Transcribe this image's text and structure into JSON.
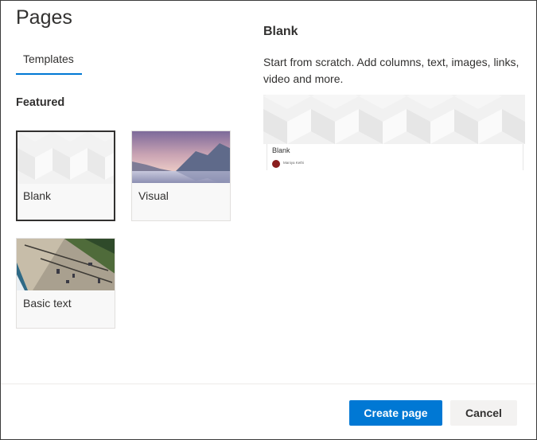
{
  "dialog": {
    "title": "Pages"
  },
  "tabs": [
    {
      "label": "Templates",
      "selected": true
    }
  ],
  "featured": {
    "section_label": "Featured",
    "templates": [
      {
        "label": "Blank",
        "selected": true
      },
      {
        "label": "Visual",
        "selected": false
      },
      {
        "label": "Basic text",
        "selected": false
      }
    ]
  },
  "preview": {
    "title": "Blank",
    "description": "Start from scratch. Add columns, text, images, links, video and more.",
    "page_title": "Blank",
    "author": "Maniya Kethi"
  },
  "actions": {
    "primary_label": "Create page",
    "secondary_label": "Cancel"
  },
  "colors": {
    "accent": "#0078d4",
    "text": "#323130",
    "selected_border": "#323130"
  }
}
